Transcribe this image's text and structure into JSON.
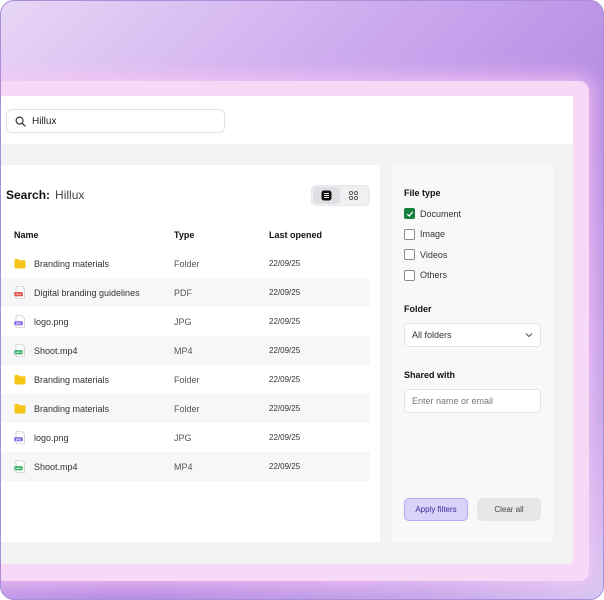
{
  "search": {
    "value": "Hillux",
    "placeholder": ""
  },
  "results": {
    "title_label": "Search:",
    "query": "Hillux",
    "columns": {
      "name": "Name",
      "type": "Type",
      "opened": "Last opened"
    },
    "rows": [
      {
        "icon": "folder-icon",
        "name": "Branding materials",
        "type": "Folder",
        "date": "22/09/25"
      },
      {
        "icon": "pdf-file-icon",
        "name": "Digital branding guidelines",
        "type": "PDF",
        "date": "22/09/25"
      },
      {
        "icon": "jpg-file-icon",
        "name": "logo.png",
        "type": "JPG",
        "date": "22/09/25"
      },
      {
        "icon": "mp4-file-icon",
        "name": "Shoot.mp4",
        "type": "MP4",
        "date": "22/09/25"
      },
      {
        "icon": "folder-icon",
        "name": "Branding materials",
        "type": "Folder",
        "date": "22/09/25"
      },
      {
        "icon": "folder-icon",
        "name": "Branding materials",
        "type": "Folder",
        "date": "22/09/25"
      },
      {
        "icon": "jpg-file-icon",
        "name": "logo.png",
        "type": "JPG",
        "date": "22/09/25"
      },
      {
        "icon": "mp4-file-icon",
        "name": "Shoot.mp4",
        "type": "MP4",
        "date": "22/09/25"
      }
    ]
  },
  "filters": {
    "file_type_heading": "File type",
    "file_types": [
      {
        "label": "Document",
        "checked": true
      },
      {
        "label": "Image",
        "checked": false
      },
      {
        "label": "Videos",
        "checked": false
      },
      {
        "label": "Others",
        "checked": false
      }
    ],
    "folder_heading": "Folder",
    "folder_value": "All folders",
    "shared_heading": "Shared with",
    "shared_placeholder": "Enter name or email",
    "apply_label": "Apply filters",
    "clear_label": "Clear all"
  },
  "colors": {
    "checked": "#15803d",
    "apply_bg": "#d9d2fb",
    "folder": "#f5c518",
    "pdf": "#d92d20",
    "jpg": "#7c5ce6",
    "mp4": "#16a34a"
  }
}
